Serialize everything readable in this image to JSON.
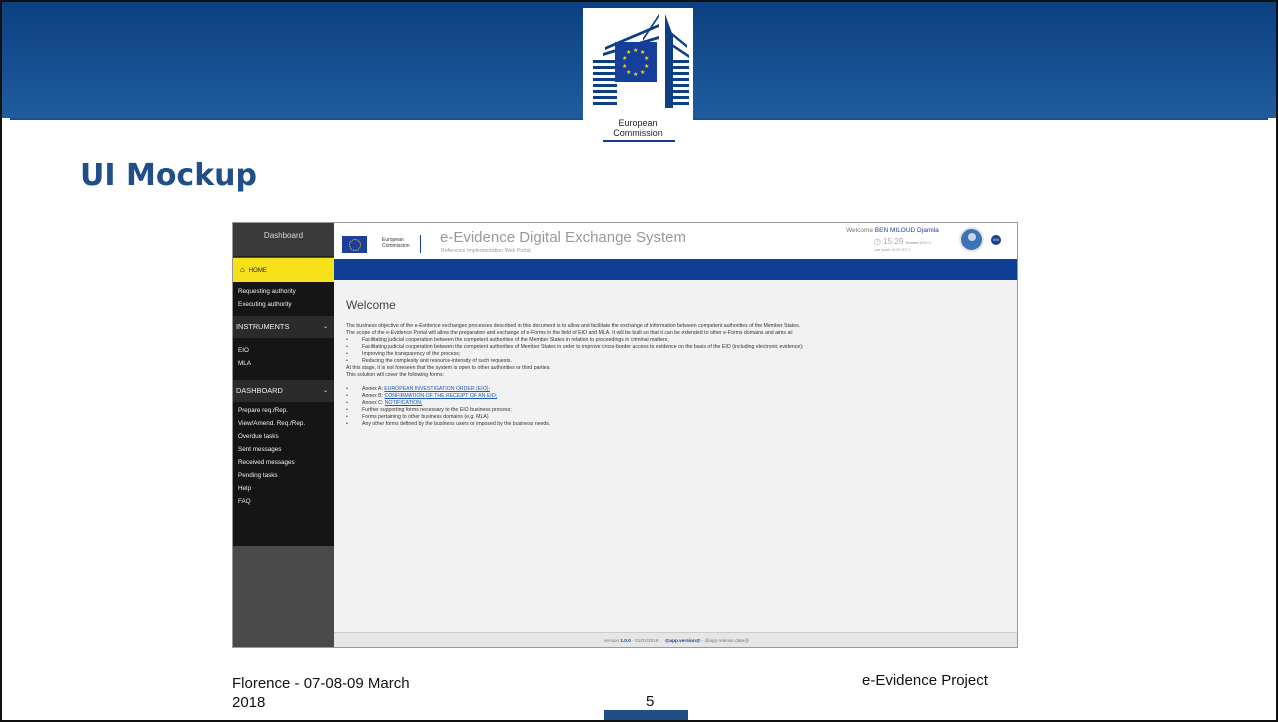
{
  "slide": {
    "title": "UI Mockup",
    "logo_text_line1": "European",
    "logo_text_line2": "Commission",
    "footer_left": "Florence - 07-08-09 March\n2018",
    "footer_right": "e-Evidence Project",
    "page_number": "5",
    "colors": {
      "band": "#1f5d9f",
      "title": "#1f4e89"
    }
  },
  "mockup": {
    "sidebar": {
      "dashboard_label": "Dashboard",
      "home_label": "HOME",
      "authority_items": [
        "Requesting authority",
        "Executing authority"
      ],
      "instruments_section": "INSTRUMENTS",
      "instrument_items": [
        "EIO",
        "MLA"
      ],
      "dashboard_section": "DASHBOARD",
      "dashboard_items": [
        "Prepare req./Rep.",
        "View/Amend. Req./Rep.",
        "Overdue tasks",
        "Sent messages",
        "Received messages",
        "Pending tasks",
        "Help",
        "FAQ"
      ]
    },
    "header": {
      "ec_text_1": "European",
      "ec_text_2": "Commission",
      "app_title": "e-Evidence Digital Exchange System",
      "app_subtitle": "Reference Implementation Web Portal",
      "welcome_prefix": "Welcome",
      "user_name": "BEN MILOUD Djamila",
      "time": "15:29",
      "time_zone": "Brussels UTC+1",
      "last_update": "Last update 16:29 UTC+1",
      "language": "EN"
    },
    "content": {
      "heading": "Welcome",
      "paragraphs": [
        "The business objective of the e-Evidence exchanges processes described in this document is to allow and facilitate the exchange of information between competent authorities of the Member States.",
        "The scope of the e-Evidence Portal will allow the preparation and exchange of e-Forms in the field of EIO and MLA. It will be built so that it can be extended to other e-Forms domains and aims at:"
      ],
      "aims": [
        "Facilitating judicial cooperation between the competent authorities of the Member States in relation to proceedings in criminal matters;",
        "Facilitating judicial cooperation between the competent authorities of Member States in order to improve cross-border access to evidence on the basis of the EIO (including electronic evidence);",
        "Improving the transparency of the process;",
        "Reducing the complexity and resource-intensity of such requests."
      ],
      "after_aims": [
        "At this stage, it is not foreseen that the system is open to other authorities or third parties.",
        "This solution will cover the following forms:"
      ],
      "annexes": [
        {
          "prefix": "Annex A: ",
          "link": "EUROPEAN INVESTIGATION ORDER (EIO);"
        },
        {
          "prefix": "Annex B: ",
          "link": "CONFIRMATION OF THE RECEIPT OF AN EIO;"
        },
        {
          "prefix": "Annex C: ",
          "link": "NOTIFICATION;"
        }
      ],
      "other_forms": [
        "Further supporting forms necessary to the EIO business process;",
        "Forms pertaining to other business domains (e.g. MLA)",
        "Any other forms defined by the business users or imposed by the business needs."
      ]
    },
    "footer": {
      "version_prefix": "version ",
      "version": "1.0.0",
      "version_date": " - 01/01/2018",
      "app_version": "@app.version@",
      "release_date": " - @app.release.date@"
    },
    "colors": {
      "home_bg": "#f6e11b",
      "blue_bar": "#0e3f94",
      "sidebar_bg": "#151515"
    }
  }
}
